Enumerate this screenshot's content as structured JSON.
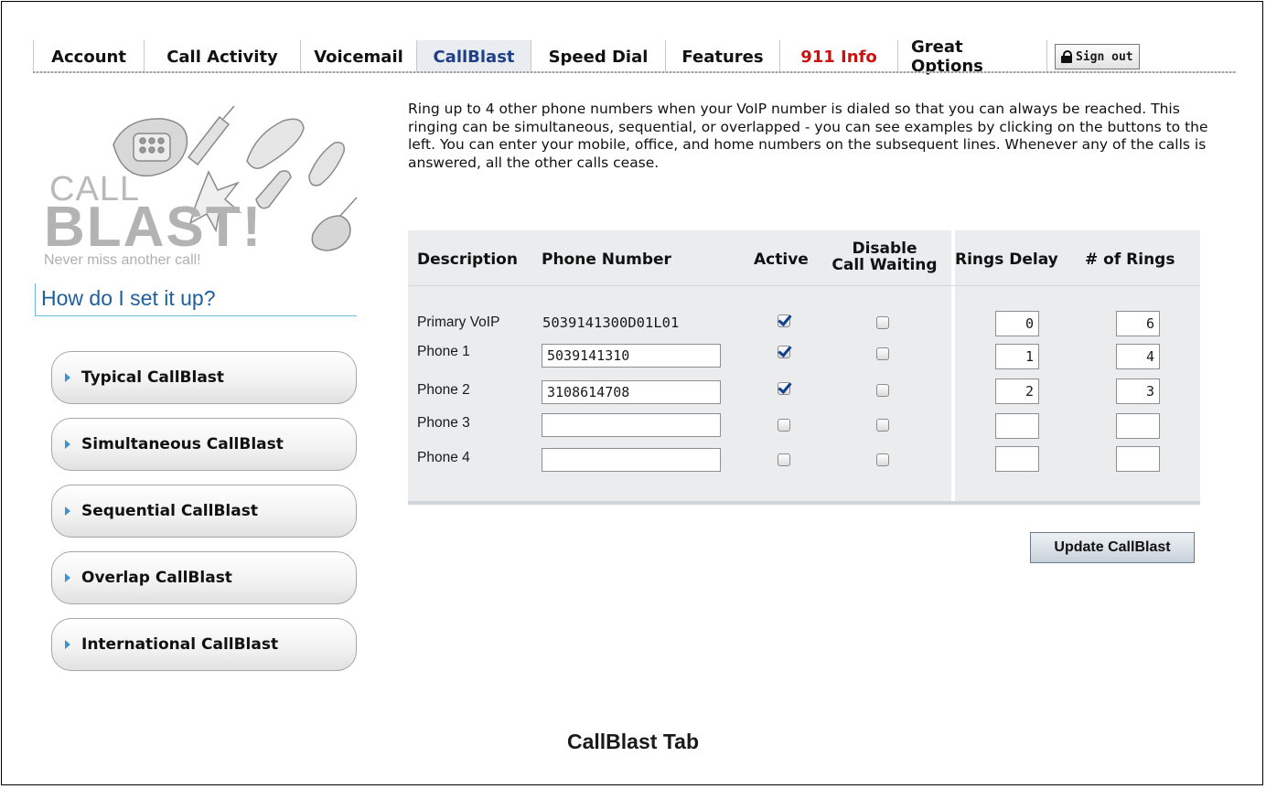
{
  "tabs": [
    {
      "label": "Account",
      "active": false
    },
    {
      "label": "Call Activity",
      "active": false
    },
    {
      "label": "Voicemail",
      "active": false
    },
    {
      "label": "CallBlast",
      "active": true
    },
    {
      "label": "Speed Dial",
      "active": false
    },
    {
      "label": "Features",
      "active": false
    },
    {
      "label": "911 Info",
      "active": false
    },
    {
      "label": "Great Options",
      "active": false
    }
  ],
  "signout_label": "Sign out",
  "logo": {
    "call": "CALL",
    "blast": "BLAST!",
    "tagline": "Never miss another call!"
  },
  "help_heading": "How do I set it up?",
  "side_buttons": [
    "Typical CallBlast",
    "Simultaneous CallBlast",
    "Sequential CallBlast",
    "Overlap CallBlast",
    "International CallBlast"
  ],
  "intro_text": "Ring up to 4 other phone numbers when your VoIP number is dialed so that you can always be reached. This ringing can be simultaneous, sequential, or overlapped - you can see examples by clicking on the buttons to the left. You can enter your mobile, office, and home numbers on the subsequent lines. Whenever any of the calls is answered, all the other calls cease.",
  "table": {
    "headers": {
      "description": "Description",
      "phone_number": "Phone Number",
      "active": "Active",
      "disable_line1": "Disable",
      "disable_line2": "Call Waiting",
      "rings_delay": "Rings Delay",
      "num_rings": "# of Rings"
    },
    "rows": [
      {
        "label": "Primary VoIP",
        "phone": "5039141300D01L01",
        "active": true,
        "disable_cw": false,
        "rings_delay": "0",
        "num_rings": "6"
      },
      {
        "label": "Phone 1",
        "phone": "5039141310",
        "active": true,
        "disable_cw": false,
        "rings_delay": "1",
        "num_rings": "4"
      },
      {
        "label": "Phone 2",
        "phone": "3108614708",
        "active": true,
        "disable_cw": false,
        "rings_delay": "2",
        "num_rings": "3"
      },
      {
        "label": "Phone 3",
        "phone": "",
        "active": false,
        "disable_cw": false,
        "rings_delay": "",
        "num_rings": ""
      },
      {
        "label": "Phone 4",
        "phone": "",
        "active": false,
        "disable_cw": false,
        "rings_delay": "",
        "num_rings": ""
      }
    ]
  },
  "update_button": "Update CallBlast",
  "caption": "CallBlast Tab"
}
